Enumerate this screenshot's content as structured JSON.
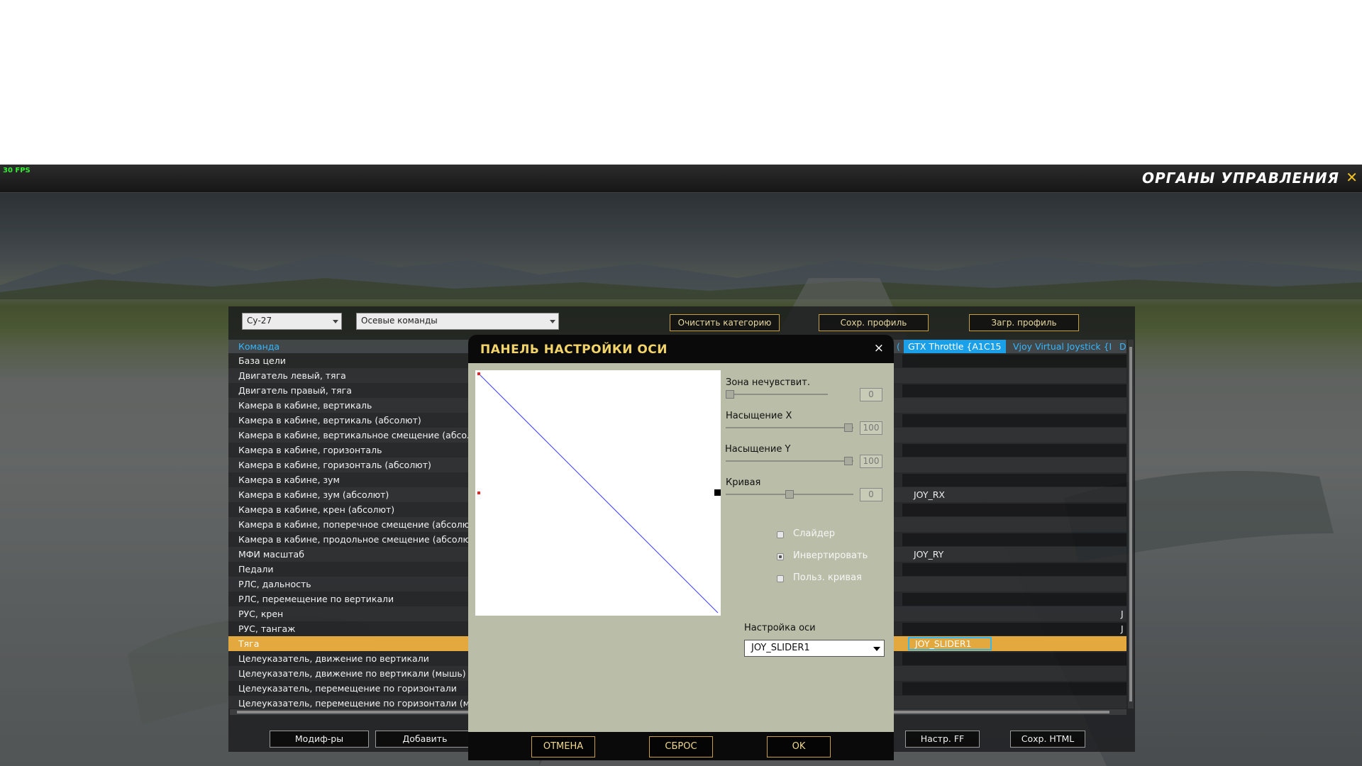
{
  "fps": "30 FPS",
  "screen_title": "ОРГАНЫ УПРАВЛЕНИЯ",
  "toolbar": {
    "aircraft_select": "Су-27",
    "category_select": "Осевые команды",
    "clear_category": "Очистить категорию",
    "save_profile": "Сохр. профиль",
    "load_profile": "Загр. профиль"
  },
  "table": {
    "header": "Команда",
    "device_columns": [
      "(",
      "GTX Throttle  {A1C15",
      "Vjoy Virtual Joystick  {E",
      "D"
    ],
    "rows": [
      {
        "command": "База цели",
        "binding": ""
      },
      {
        "command": "Двигатель левый, тяга",
        "binding": ""
      },
      {
        "command": "Двигатель правый, тяга",
        "binding": ""
      },
      {
        "command": "Камера в кабине, вертикаль",
        "binding": ""
      },
      {
        "command": "Камера в кабине, вертикаль (абсолют)",
        "binding": ""
      },
      {
        "command": "Камера в кабине, вертикальное смещение (абсолют",
        "binding": ""
      },
      {
        "command": "Камера в кабине, горизонталь",
        "binding": ""
      },
      {
        "command": "Камера в кабине, горизонталь (абсолют)",
        "binding": ""
      },
      {
        "command": "Камера в кабине, зум",
        "binding": ""
      },
      {
        "command": "Камера в кабине, зум (абсолют)",
        "binding": "JOY_RX"
      },
      {
        "command": "Камера в кабине, крен (абсолют)",
        "binding": ""
      },
      {
        "command": "Камера в кабине, поперечное смещение (абсолют)",
        "binding": ""
      },
      {
        "command": "Камера в кабине, продольное смещение (абсолют)",
        "binding": ""
      },
      {
        "command": "МФИ масштаб",
        "binding": "JOY_RY"
      },
      {
        "command": "Педали",
        "binding": ""
      },
      {
        "command": "РЛС, дальность",
        "binding": ""
      },
      {
        "command": "РЛС, перемещение по вертикали",
        "binding": ""
      },
      {
        "command": "РУС, крен",
        "binding": "",
        "edge": "J"
      },
      {
        "command": "РУС, тангаж",
        "binding": "",
        "edge": "J"
      },
      {
        "command": "Тяга",
        "binding": "JOY_SLIDER1"
      },
      {
        "command": "Целеуказатель, движение по вертикали",
        "binding": ""
      },
      {
        "command": "Целеуказатель, движение по вертикали (мышь)",
        "binding": ""
      },
      {
        "command": "Целеуказатель, перемещение по горизонтали",
        "binding": ""
      },
      {
        "command": "Целеуказатель, перемещение по горизонтали (мыш",
        "binding": ""
      }
    ]
  },
  "bottom_buttons": {
    "modifiers": "Модиф-ры",
    "add": "Добавить",
    "ff_settings": "Настр. FF",
    "save_html": "Сохр. HTML"
  },
  "dialog": {
    "title": "ПАНЕЛЬ НАСТРОЙКИ ОСИ",
    "close": "×",
    "deadzone_label": "Зона нечувствит.",
    "deadzone_value": "0",
    "saturation_x_label": "Насыщение X",
    "saturation_x_value": "100",
    "saturation_y_label": "Насыщение Y",
    "saturation_y_value": "100",
    "curve_label": "Кривая",
    "curve_value": "0",
    "slider_label": "Слайдер",
    "slider_checked": false,
    "invert_label": "Инвертировать",
    "invert_checked": true,
    "user_curve_label": "Польз. кривая",
    "user_curve_checked": false,
    "axis_setting_label": "Настройка оси",
    "axis_value": "JOY_SLIDER1",
    "cancel": "ОТМЕНА",
    "reset": "СБРОС",
    "ok": "OK"
  },
  "colors": {
    "selected_row": "#e3a83e",
    "header_text": "#33b8ff",
    "dialog_title": "#f2d46a",
    "dialog_body": "#babea8"
  }
}
